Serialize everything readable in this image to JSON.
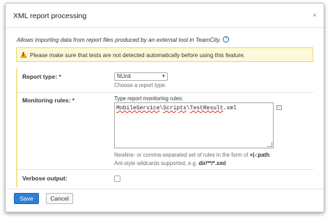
{
  "dialog": {
    "title": "XML report processing",
    "close_glyph": "×",
    "description": "Allows importing data from report files produced by an external tool in TeamCity.",
    "help_glyph": "?",
    "warning": "Please make sure that tests are not detected automatically before using this feature.",
    "warning_glyph": "!"
  },
  "form": {
    "report_type": {
      "label": "Report type:",
      "required": "*",
      "value": "NUnit",
      "hint": "Choose a report type."
    },
    "monitoring_rules": {
      "label": "Monitoring rules:",
      "required": "*",
      "caption": "Type report monitoring rules:",
      "value_parts": [
        "MobileService",
        "\\",
        "Scripts",
        "\\",
        "TestResult",
        ".xml"
      ],
      "hint1_prefix": "Newline- or comma-separated set of rules in the form of ",
      "hint1_bold": "+|-:path",
      "hint1_suffix": ".",
      "hint2_prefix": "Ant-style wildcards supported, e.g. ",
      "hint2_bold": "dir/**/*.xml"
    },
    "verbose_output": {
      "label": "Verbose output:"
    }
  },
  "buttons": {
    "save": "Save",
    "cancel": "Cancel"
  },
  "colors": {
    "primary_button": "#2f7fd6",
    "warning_background": "#fdf8d9",
    "warning_border": "#e8d775",
    "required": "#dd0000"
  }
}
